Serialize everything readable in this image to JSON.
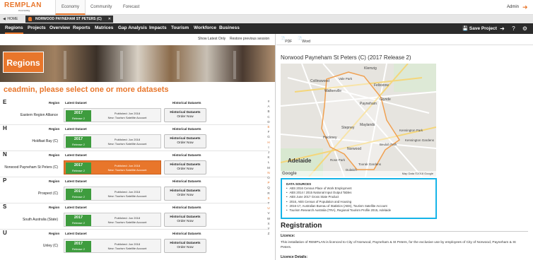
{
  "app": {
    "logo_text": "REMPLAN",
    "logo_sub": "economy"
  },
  "top_tabs": [
    {
      "label": "Economy"
    },
    {
      "label": "Community"
    },
    {
      "label": "Forecast"
    }
  ],
  "user": {
    "name": "Admin"
  },
  "breadcrumb": {
    "home": "HOME",
    "region": "NORWOOD PAYNEHAM ST PETERS (C) (2017 R2)"
  },
  "nav": {
    "items": [
      "Regions",
      "Projects",
      "Overview",
      "Reports",
      "Matrices",
      "Gap Analysis",
      "Impacts",
      "Tourism",
      "Workforce",
      "Business"
    ],
    "save_label": "Save Project"
  },
  "left": {
    "show_latest": "Show Latest Only",
    "restore": "Restore previous session",
    "hero_title": "Regions",
    "heading": "ceadmin, please select one or more datasets",
    "col_region": "Region",
    "col_latest": "Latest Dataset",
    "col_hist": "Historical Datasets",
    "groups": [
      {
        "letter": "E",
        "region": "Eastern Region Alliance",
        "year": "2017",
        "release": "Release 2",
        "published": "Published: Jun 2018",
        "new": "New: Tourism Satellite Account",
        "hist": "Historical Datasets",
        "order": "Order Now",
        "selected": false
      },
      {
        "letter": "H",
        "region": "Holdfast Bay (C)",
        "year": "2017",
        "release": "Release 2",
        "published": "Published: Jun 2018",
        "new": "New: Tourism Satellite Account",
        "hist": "Historical Datasets",
        "order": "Order Now",
        "selected": false
      },
      {
        "letter": "N",
        "region": "Norwood Payneham St Peters (C)",
        "year": "2017",
        "release": "Release 2",
        "published": "Published: Jun 2018",
        "new": "New: Tourism Satellite Account",
        "hist": "Historical Datasets",
        "order": "Order Now",
        "selected": true
      },
      {
        "letter": "P",
        "region": "Prospect (C)",
        "year": "2017",
        "release": "Release 2",
        "published": "Published: Jun 2018",
        "new": "New: Tourism Satellite Account",
        "hist": "Historical Datasets",
        "order": "Order Now",
        "selected": false
      },
      {
        "letter": "S",
        "region": "South Australia (State)",
        "year": "2017",
        "release": "Release 2",
        "published": "Published: Jun 2018",
        "new": "New: Tourism Satellite Account",
        "hist": "Historical Datasets",
        "order": "Order Now",
        "selected": false
      },
      {
        "letter": "U",
        "region": "Unley (C)",
        "year": "2017",
        "release": "Release 2",
        "published": "Published: Jun 2018",
        "new": "New: Tourism Satellite Account",
        "hist": "Historical Datasets",
        "order": "Order Now",
        "selected": false
      }
    ],
    "az": [
      "#",
      "A",
      "B",
      "C",
      "D",
      "E",
      "F",
      "G",
      "H",
      "I",
      "J",
      "K",
      "L",
      "M",
      "N",
      "O",
      "P",
      "Q",
      "R",
      "S",
      "T",
      "U",
      "V",
      "W",
      "X",
      "Y",
      "Z"
    ]
  },
  "right": {
    "pdf": "PDF",
    "word": "Word",
    "title": "Norwood Payneham St Peters (C) (2017 Release 2)",
    "map_labels": [
      "Klemzig",
      "Collinswood",
      "Vale Park",
      "Felixstow",
      "Walkerville",
      "Glynde",
      "Payneham",
      "Stepney",
      "Maylands",
      "Hackney",
      "Norwood",
      "Beulah Park",
      "Kensington Park",
      "Kensington Gardens",
      "Rose Park",
      "Toorak Gardens",
      "Dulwich",
      "Adelaide"
    ],
    "map_credit": "Map Data ©2018 Google",
    "google": "Google",
    "ds_heading": "DATA SOURCES",
    "data_sources": [
      "ABS 2016 Census Place of Work Employment",
      "ABS 2014 / 2015 National Input Output Tables",
      "ABS June 2017 Gross State Product",
      "2016, ABS Census of Population and Housing",
      "2016-17, Australian Bureau of Statistics (ABS), Tourism Satellite Account",
      "Tourism Research Australia (TRA), Regional Tourism Profile 2015, Adelaide"
    ],
    "registration": "Registration",
    "licence": "Licence:",
    "licence_text": "This installation of REMPLAN is licenced to City of Norwood, Payneham & St Peters, for the exclusive use by employees of City of Norwood, Payneham & St Peters.",
    "licence_details": "Licence Details:"
  },
  "colors": {
    "accent": "#e8762b",
    "green": "#3e9c3e",
    "highlight": "#15b4e8",
    "navbar": "#2b2b2b"
  }
}
